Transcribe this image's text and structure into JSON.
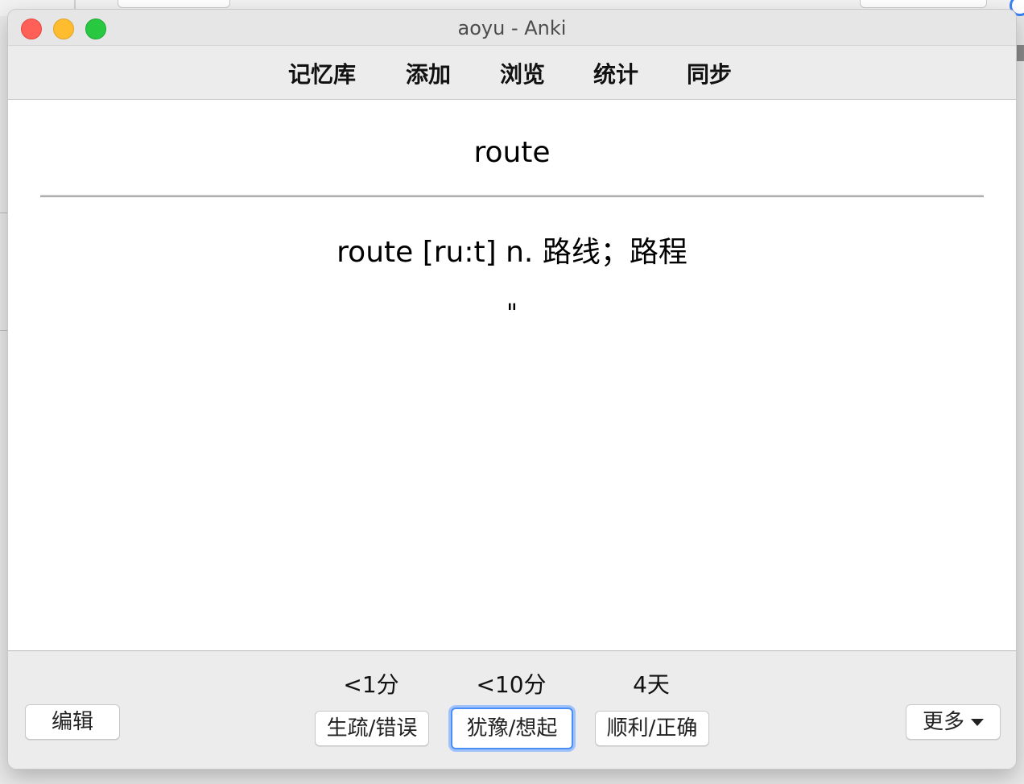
{
  "window": {
    "title": "aoyu - Anki"
  },
  "toolbar": {
    "items": [
      "记忆库",
      "添加",
      "浏览",
      "统计",
      "同步"
    ]
  },
  "card": {
    "front": "route",
    "back": "route [ru:t] n. 路线；路程",
    "extra": "\""
  },
  "bottom": {
    "edit_label": "编辑",
    "more_label": "更多",
    "intervals": [
      "<1分",
      "<10分",
      "4天"
    ],
    "answers": [
      "生疏/错误",
      "犹豫/想起",
      "顺利/正确"
    ]
  },
  "icons": {
    "more": "chevron-down-icon"
  },
  "colors": {
    "focus_ring": "#4a8ff7",
    "close": "#fe5f57",
    "minimize": "#febc2e",
    "zoom": "#28c840"
  }
}
